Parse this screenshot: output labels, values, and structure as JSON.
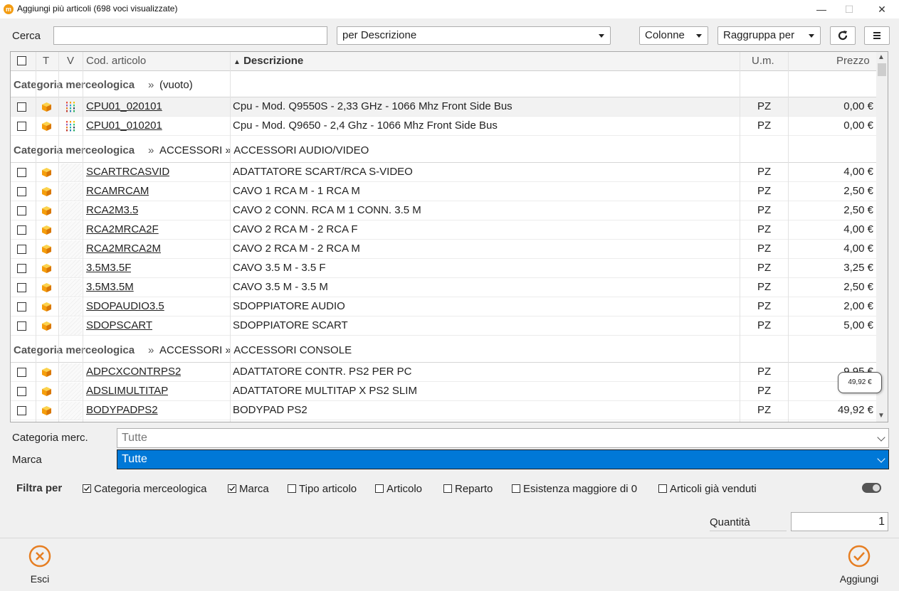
{
  "window": {
    "title": "Aggiungi più articoli (698 voci visualizzate)",
    "app_icon": "m",
    "controls": [
      "—",
      "☐",
      "✕"
    ]
  },
  "toolbar": {
    "search_label": "Cerca",
    "search_value": "",
    "search_mode": "per Descrizione",
    "columns_label": "Colonne",
    "group_label": "Raggruppa per"
  },
  "grid": {
    "headers": {
      "t": "T",
      "v": "V",
      "code": "Cod. articolo",
      "desc": "Descrizione",
      "um": "U.m.",
      "price": "Prezzo"
    },
    "sort_indicator": "▲",
    "groups": [
      {
        "prefix": "Categoria merceologica",
        "sep": "»",
        "path": "(vuoto)",
        "rows": [
          {
            "code": "CPU01_020101",
            "desc": "Cpu - Mod. Q9550S - 2,33 GHz - 1066 Mhz Front Side Bus",
            "um": "PZ",
            "price": "0,00 €",
            "variant": true
          },
          {
            "code": "CPU01_010201",
            "desc": "Cpu - Mod. Q9650 - 2,4 Ghz - 1066 Mhz Front Side Bus",
            "um": "PZ",
            "price": "0,00 €",
            "variant": true
          }
        ]
      },
      {
        "prefix": "Categoria merceologica",
        "sep": "»",
        "path": "ACCESSORI » ACCESSORI AUDIO/VIDEO",
        "rows": [
          {
            "code": "SCARTRCASVID",
            "desc": "ADATTATORE SCART/RCA S-VIDEO",
            "um": "PZ",
            "price": "4,00 €"
          },
          {
            "code": "RCAMRCAM",
            "desc": "CAVO 1 RCA M - 1 RCA M",
            "um": "PZ",
            "price": "2,50 €"
          },
          {
            "code": "RCA2M3.5",
            "desc": "CAVO 2 CONN. RCA M 1 CONN. 3.5 M",
            "um": "PZ",
            "price": "2,50 €"
          },
          {
            "code": "RCA2MRCA2F",
            "desc": "CAVO 2 RCA M - 2 RCA F",
            "um": "PZ",
            "price": "4,00 €"
          },
          {
            "code": "RCA2MRCA2M",
            "desc": "CAVO 2 RCA M - 2 RCA M",
            "um": "PZ",
            "price": "4,00 €"
          },
          {
            "code": "3.5M3.5F",
            "desc": "CAVO 3.5 M - 3.5 F",
            "um": "PZ",
            "price": "3,25 €"
          },
          {
            "code": "3.5M3.5M",
            "desc": "CAVO 3.5 M - 3.5 M",
            "um": "PZ",
            "price": "2,50 €"
          },
          {
            "code": "SDOPAUDIO3.5",
            "desc": "SDOPPIATORE AUDIO",
            "um": "PZ",
            "price": "2,00 €"
          },
          {
            "code": "SDOPSCART",
            "desc": "SDOPPIATORE SCART",
            "um": "PZ",
            "price": "5,00 €"
          }
        ]
      },
      {
        "prefix": "Categoria merceologica",
        "sep": "»",
        "path": "ACCESSORI » ACCESSORI CONSOLE",
        "rows": [
          {
            "code": "ADPCXCONTRPS2",
            "desc": "ADATTATORE CONTR. PS2 PER PC",
            "um": "PZ",
            "price": "9,95 €"
          },
          {
            "code": "ADSLIMULTITAP",
            "desc": "ADATTATORE MULTITAP X PS2 SLIM",
            "um": "PZ",
            "price": ""
          },
          {
            "code": "BODYPADPS2",
            "desc": "BODYPAD PS2",
            "um": "PZ",
            "price": "49,92 €"
          }
        ]
      }
    ],
    "tooltip": "49,92 €"
  },
  "filters": {
    "category_label": "Categoria merc.",
    "category_value": "Tutte",
    "brand_label": "Marca",
    "brand_value": "Tutte",
    "filter_by_label": "Filtra per",
    "checks": [
      {
        "label": "Categoria merceologica",
        "checked": true
      },
      {
        "label": "Marca",
        "checked": true
      },
      {
        "label": "Tipo articolo",
        "checked": false
      },
      {
        "label": "Articolo",
        "checked": false
      },
      {
        "label": "Reparto",
        "checked": false
      },
      {
        "label": "Esistenza maggiore di 0",
        "checked": false
      },
      {
        "label": "Articoli già venduti",
        "checked": false
      }
    ],
    "toggle_on": false
  },
  "quantity": {
    "label": "Quantità",
    "value": "1"
  },
  "footer": {
    "exit_label": "Esci",
    "add_label": "Aggiungi",
    "accent": "#e67e22"
  }
}
